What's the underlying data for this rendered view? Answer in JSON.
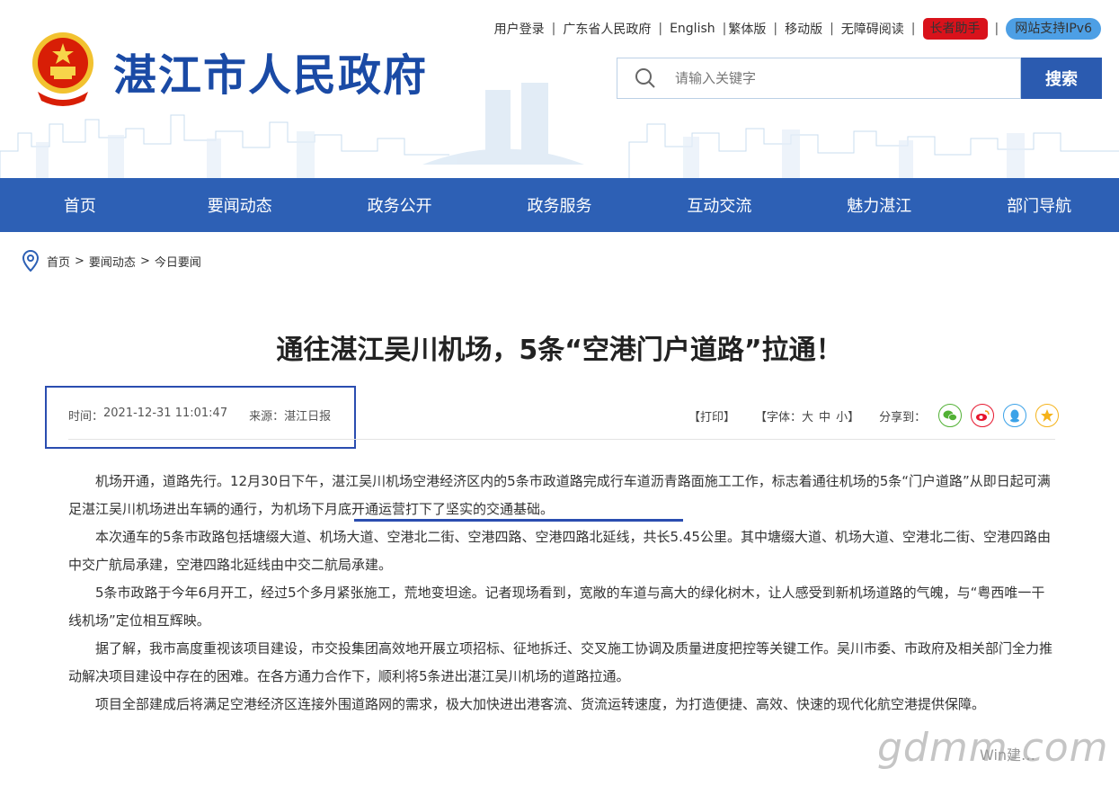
{
  "header": {
    "site_title": "湛江市人民政府",
    "toplinks": {
      "login": "用户登录",
      "province": "广东省人民政府",
      "english": "English",
      "traditional": "繁体版",
      "mobile": "移动版",
      "accessible": "无障碍阅读",
      "elder": "长者助手",
      "ipv6": "网站支持IPv6"
    },
    "search": {
      "placeholder": "请输入关键字",
      "button": "搜索"
    }
  },
  "nav": {
    "items": [
      "首页",
      "要闻动态",
      "政务公开",
      "政务服务",
      "互动交流",
      "魅力湛江",
      "部门导航"
    ]
  },
  "breadcrumb": {
    "home": "首页",
    "level1": "要闻动态",
    "level2": "今日要闻"
  },
  "article": {
    "title": "通往湛江吴川机场，5条“空港门户道路”拉通！",
    "time_label": "时间：",
    "time": "2021-12-31 11:01:47",
    "source_label": "来源：",
    "source": "湛江日报",
    "print": "【打印】",
    "font_label": "【字体：",
    "font_large": "大",
    "font_medium": "中",
    "font_small": "小",
    "font_close": "】",
    "share_label": "分享到：",
    "paragraphs": [
      "机场开通，道路先行。12月30日下午，湛江吴川机场空港经济区内的5条市政道路完成行车道沥青路面施工工作，标志着通往机场的5条“门户道路”从即日起可满足湛江吴川机场进出车辆的通行，为机场下月底开通运营打下了坚实的交通基础。",
      "本次通车的5条市政路包括塘缀大道、机场大道、空港北二街、空港四路、空港四路北延线，共长5.45公里。其中塘缀大道、机场大道、空港北二街、空港四路由中交广航局承建，空港四路北延线由中交二航局承建。",
      "5条市政路于今年6月开工，经过5个多月紧张施工，荒地变坦途。记者现场看到，宽敞的车道与高大的绿化树木，让人感受到新机场道路的气魄，与“粤西唯一干线机场”定位相互辉映。",
      "据了解，我市高度重视该项目建设，市交投集团高效地开展立项招标、征地拆迁、交叉施工协调及质量进度把控等关键工作。吴川市委、市政府及相关部门全力推动解决项目建设中存在的困难。在各方通力合作下，顺利将5条进出湛江吴川机场的道路拉通。",
      "项目全部建成后将满足空港经济区连接外围道路网的需求，极大加快进出港客流、货流运转速度，为打造便捷、高效、快速的现代化航空港提供保障。"
    ]
  },
  "watermark": {
    "text": "gdmm.com",
    "sub": "Win建…"
  },
  "colors": {
    "brand_blue": "#2d60b5",
    "title_blue": "#1a4aa5",
    "elder_red": "#d9121b",
    "ipv6_blue": "#4d9fe5",
    "annotation_blue": "#2a4db0"
  }
}
